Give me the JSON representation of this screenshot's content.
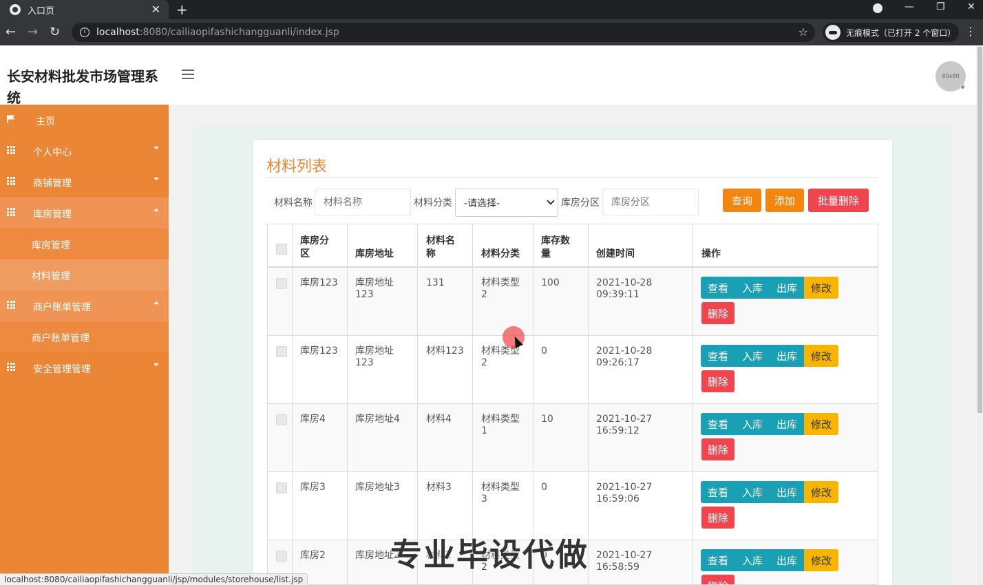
{
  "browser": {
    "tab_title": "入口页",
    "url_host": "localhost",
    "url_path": ":8080/cailiaopifashichangguanli/index.jsp",
    "incognito_label": "无痕模式（已打开 2 个窗口）"
  },
  "app": {
    "title": "长安材料批发市场管理系统",
    "avatar_text": "80x80"
  },
  "sidebar": {
    "items": [
      {
        "label": "主页",
        "icon": "flag-icon"
      },
      {
        "label": "个人中心",
        "icon": "grid-icon"
      },
      {
        "label": "商铺管理",
        "icon": "grid-icon"
      },
      {
        "label": "库房管理",
        "icon": "grid-icon"
      },
      {
        "label": "库房管理"
      },
      {
        "label": "材料管理"
      },
      {
        "label": "商户账单管理",
        "icon": "grid-icon"
      },
      {
        "label": "商户账单管理"
      },
      {
        "label": "安全管理管理",
        "icon": "grid-icon"
      }
    ]
  },
  "panel": {
    "title": "材料列表",
    "search": {
      "name_label": "材料名称",
      "name_placeholder": "材料名称",
      "category_label": "材料分类",
      "category_value": "-请选择-",
      "zone_label": "库房分区",
      "zone_placeholder": "库房分区"
    },
    "buttons": {
      "query": "查询",
      "add": "添加",
      "batch_delete": "批量删除"
    }
  },
  "table": {
    "headers": [
      "库房分区",
      "库房地址",
      "材料名称",
      "材料分类",
      "库存数量",
      "创建时间",
      "操作"
    ],
    "header_lines": [
      [
        "库房分",
        "区"
      ],
      [
        "库房地址"
      ],
      [
        "材料名",
        "称"
      ],
      [
        "材料分类"
      ],
      [
        "库存数",
        "量"
      ],
      [
        "创建时间"
      ],
      [
        "操作"
      ]
    ],
    "actions": {
      "view": "查看",
      "in": "入库",
      "out": "出库",
      "edit": "修改",
      "delete": "删除"
    },
    "rows": [
      {
        "zone": "库房123",
        "addr1": "库房地址",
        "addr2": "123",
        "name": "131",
        "cat1": "材料类型",
        "cat2": "2",
        "qty": "100",
        "date": "2021-10-28",
        "time": "09:39:11"
      },
      {
        "zone": "库房123",
        "addr1": "库房地址",
        "addr2": "123",
        "name": "材料123",
        "cat1": "材料类型",
        "cat2": "2",
        "qty": "0",
        "date": "2021-10-28",
        "time": "09:26:17"
      },
      {
        "zone": "库房4",
        "addr1": "库房地址4",
        "addr2": "",
        "name": "材料4",
        "cat1": "材料类型",
        "cat2": "1",
        "qty": "10",
        "date": "2021-10-27",
        "time": "16:59:12"
      },
      {
        "zone": "库房3",
        "addr1": "库房地址3",
        "addr2": "",
        "name": "材料3",
        "cat1": "材料类型",
        "cat2": "3",
        "qty": "0",
        "date": "2021-10-27",
        "time": "16:59:06"
      },
      {
        "zone": "库房2",
        "addr1": "库房地址2",
        "addr2": "",
        "name": "材料2",
        "cat1": "材料类型",
        "cat2": "2",
        "qty": "0",
        "date": "2021-10-27",
        "time": "16:58:59"
      }
    ]
  },
  "overlay": {
    "watermark": "专业毕设代做",
    "status_url": "localhost:8080/cailiaopifashichangguanli/jsp/modules/storehouse/list.jsp"
  },
  "colors": {
    "sidebar": "#ec8637",
    "accent": "#f4850e",
    "danger": "#f0444f",
    "info": "#1aa0b4",
    "warning": "#f7b500"
  }
}
